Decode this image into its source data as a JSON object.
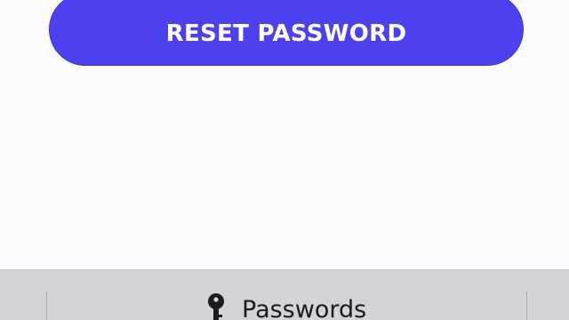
{
  "main": {
    "reset_button_label": "RESET PASSWORD"
  },
  "bottom_bar": {
    "passwords_label": "Passwords",
    "passwords_icon": "key-icon"
  },
  "colors": {
    "accent": "#4b41f0",
    "background": "#fcfbfe",
    "bar_background": "#d3d4d8"
  }
}
